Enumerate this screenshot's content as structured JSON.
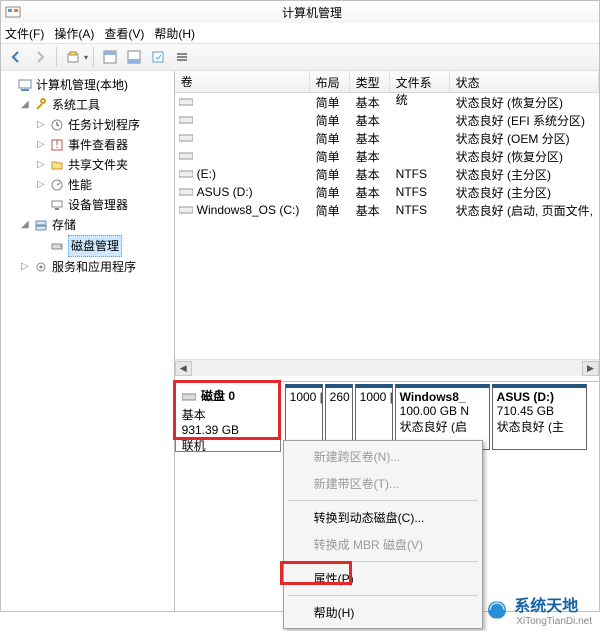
{
  "window": {
    "title": "计算机管理"
  },
  "menu": {
    "file": "文件(F)",
    "action": "操作(A)",
    "view": "查看(V)",
    "help": "帮助(H)"
  },
  "tree": {
    "root": "计算机管理(本地)",
    "system_tools": "系统工具",
    "task_scheduler": "任务计划程序",
    "event_viewer": "事件查看器",
    "shared_folders": "共享文件夹",
    "performance": "性能",
    "device_manager": "设备管理器",
    "storage": "存储",
    "disk_mgmt": "磁盘管理",
    "services_apps": "服务和应用程序"
  },
  "vol_header": {
    "vol": "卷",
    "layout": "布局",
    "type": "类型",
    "fs": "文件系统",
    "status": "状态"
  },
  "volumes": [
    {
      "name": "",
      "layout": "简单",
      "type": "基本",
      "fs": "",
      "status": "状态良好 (恢复分区)"
    },
    {
      "name": "",
      "layout": "简单",
      "type": "基本",
      "fs": "",
      "status": "状态良好 (EFI 系统分区)"
    },
    {
      "name": "",
      "layout": "简单",
      "type": "基本",
      "fs": "",
      "status": "状态良好 (OEM 分区)"
    },
    {
      "name": "",
      "layout": "简单",
      "type": "基本",
      "fs": "",
      "status": "状态良好 (恢复分区)"
    },
    {
      "name": "(E:)",
      "layout": "简单",
      "type": "基本",
      "fs": "NTFS",
      "status": "状态良好 (主分区)"
    },
    {
      "name": "ASUS (D:)",
      "layout": "简单",
      "type": "基本",
      "fs": "NTFS",
      "status": "状态良好 (主分区)"
    },
    {
      "name": "Windows8_OS (C:)",
      "layout": "简单",
      "type": "基本",
      "fs": "NTFS",
      "status": "状态良好 (启动, 页面文件,"
    }
  ],
  "disk": {
    "label": "磁盘 0",
    "dtype": "基本",
    "size": "931.39 GB",
    "status": "联机"
  },
  "parts": [
    {
      "name": "",
      "size": "1000 |",
      "stat": ""
    },
    {
      "name": "",
      "size": "260",
      "stat": ""
    },
    {
      "name": "",
      "size": "1000 |",
      "stat": ""
    },
    {
      "name": "Windows8_",
      "size": "100.00 GB N",
      "stat": "状态良好 (启"
    },
    {
      "name": "ASUS   (D:)",
      "size": "710.45 GB",
      "stat": "状态良好 (主"
    }
  ],
  "ctx": {
    "new_spanned": "新建跨区卷(N)...",
    "new_striped": "新建带区卷(T)...",
    "to_dynamic": "转换到动态磁盘(C)...",
    "to_mbr": "转换成 MBR 磁盘(V)",
    "properties": "属性(P)",
    "help": "帮助(H)"
  },
  "watermark": {
    "text": "系统天地",
    "sub": "XiTongTianDi.net"
  }
}
